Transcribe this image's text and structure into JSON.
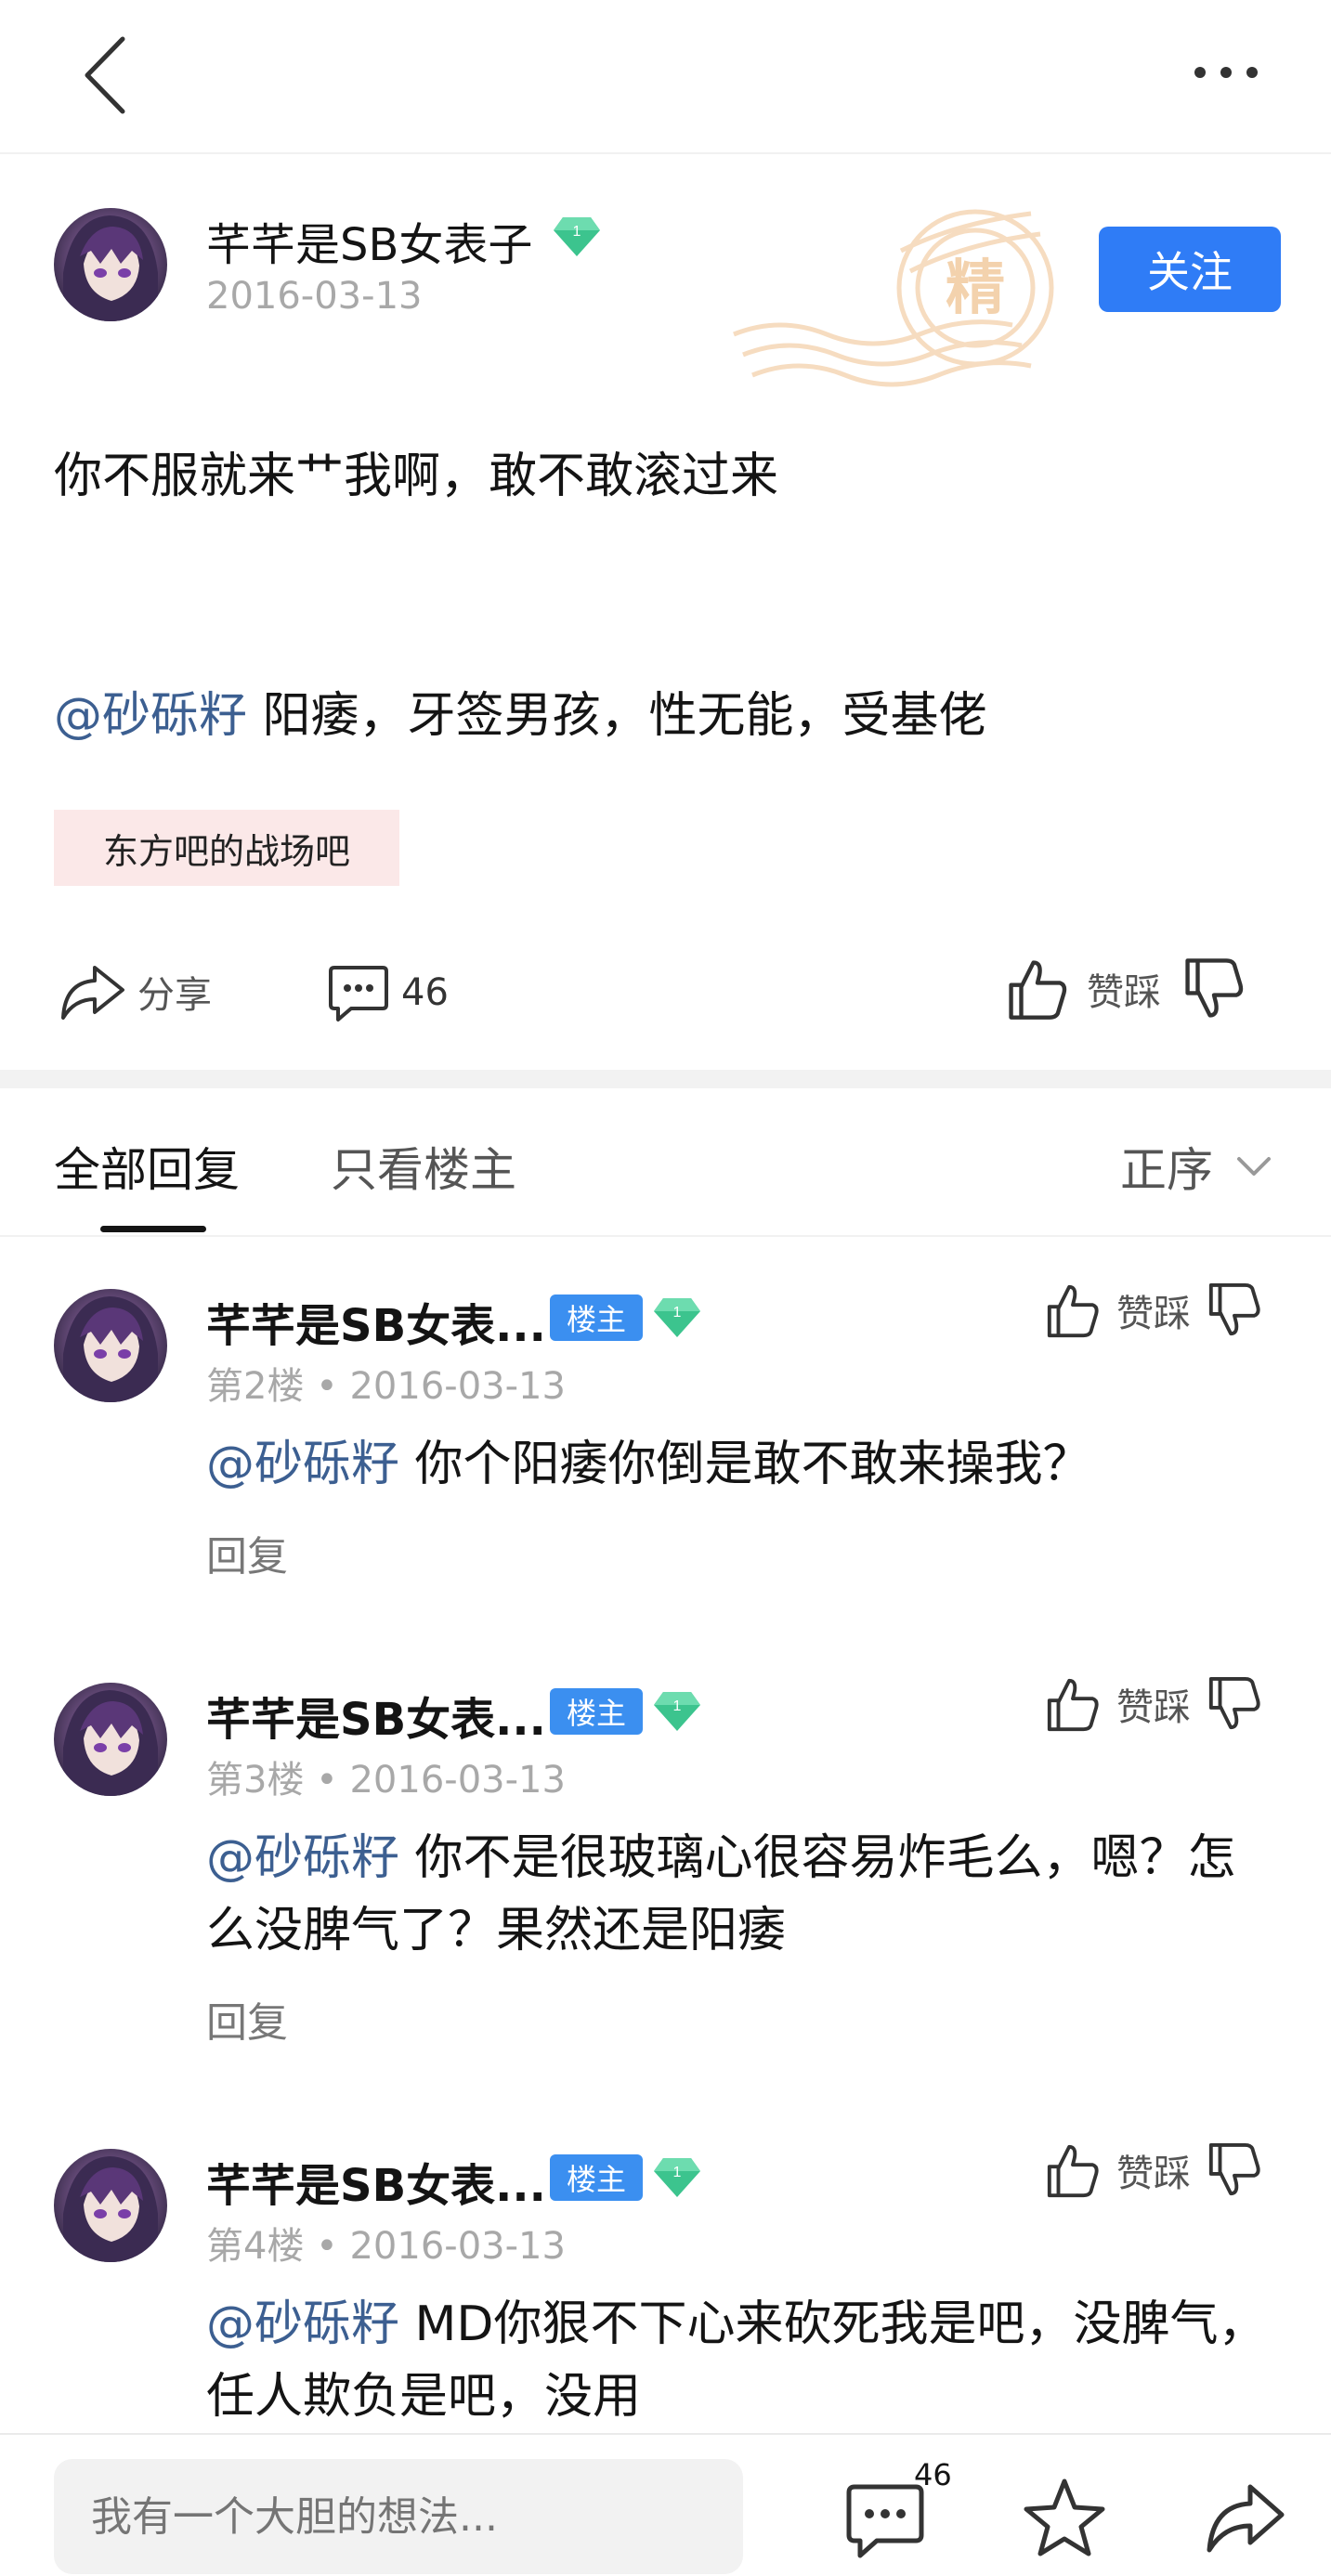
{
  "colors": {
    "accent": "#2f7cf6",
    "mention": "#3c5f91",
    "tag_bg": "#fbe8e8",
    "owner_badge": "#3b8ff0",
    "gem": "#3cc48e"
  },
  "nav": {
    "back_icon": "chevron-left-icon",
    "more_icon": "more-dots-icon"
  },
  "post": {
    "author": "芊芊是SB女表子",
    "level": "1",
    "date": "2016-03-13",
    "stamp_char": "精",
    "follow_label": "关注",
    "line1": "你不服就来艹我啊，敢不敢滚过来",
    "mention": "@砂砾籽",
    "line2": " 阳痿，牙签男孩，性无能，受基佬",
    "forum_tag": "东方吧的战场吧",
    "share_label": "分享",
    "comment_count": "46",
    "vote_label": "赞踩"
  },
  "tabs": {
    "all": "全部回复",
    "owner_only": "只看楼主",
    "sort": "正序"
  },
  "replies": [
    {
      "name": "芊芊是SB女表...",
      "badge": "楼主",
      "level": "1",
      "floor": "第2楼",
      "dot": "•",
      "date": "2016-03-13",
      "vote": "赞踩",
      "mention": "@砂砾籽",
      "text": " 你个阳痿你倒是敢不敢来操我？",
      "reply_label": "回复"
    },
    {
      "name": "芊芊是SB女表...",
      "badge": "楼主",
      "level": "1",
      "floor": "第3楼",
      "dot": "•",
      "date": "2016-03-13",
      "vote": "赞踩",
      "mention": "@砂砾籽",
      "text": " 你不是很玻璃心很容易炸毛么，嗯？怎么没脾气了？果然还是阳痿",
      "reply_label": "回复"
    },
    {
      "name": "芊芊是SB女表...",
      "badge": "楼主",
      "level": "1",
      "floor": "第4楼",
      "dot": "•",
      "date": "2016-03-13",
      "vote": "赞踩",
      "mention": "@砂砾籽",
      "text": " MD你狠不下心来砍死我是吧，没脾气，任人欺负是吧，没用",
      "reply_label": ""
    }
  ],
  "bottom": {
    "input_placeholder": "我有一个大胆的想法...",
    "comment_count": "46"
  }
}
